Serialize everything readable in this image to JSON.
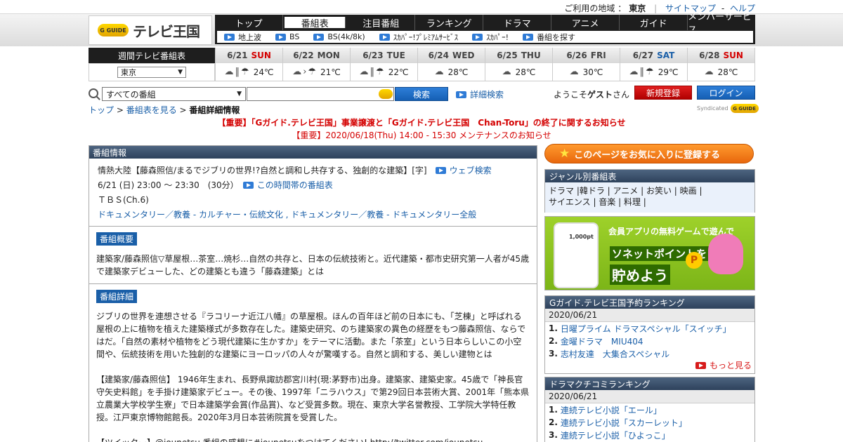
{
  "top": {
    "region_label": "ご利用の地域 ：",
    "region": "東京",
    "sitemap": "サイトマップ",
    "dash": "-",
    "help": "ヘルプ"
  },
  "logo": {
    "badge": "G GUIDE",
    "text": "テレビ王国"
  },
  "nav": [
    "トップ",
    "番組表",
    "注目番組",
    "ランキング",
    "ドラマ",
    "アニメ",
    "ガイド",
    "メンバーサービス"
  ],
  "subnav": [
    "地上波",
    "BS",
    "BS(4k/8k)",
    "ｽｶﾊﾟｰ!ﾌﾟﾚﾐｱﾑｻｰﾋﾞｽ",
    "ｽｶﾊﾟｰ!",
    "番組を探す"
  ],
  "week": {
    "title": "週間テレビ番組表",
    "area": "東京",
    "caret": "▼"
  },
  "days": [
    {
      "date": "6/21",
      "wd": "SUN",
      "temp": "24℃"
    },
    {
      "date": "6/22",
      "wd": "MON",
      "temp": "21℃"
    },
    {
      "date": "6/23",
      "wd": "TUE",
      "temp": "22℃"
    },
    {
      "date": "6/24",
      "wd": "WED",
      "temp": "28℃"
    },
    {
      "date": "6/25",
      "wd": "THU",
      "temp": "28℃"
    },
    {
      "date": "6/26",
      "wd": "FRI",
      "temp": "30℃"
    },
    {
      "date": "6/27",
      "wd": "SAT",
      "temp": "29℃"
    },
    {
      "date": "6/28",
      "wd": "SUN",
      "temp": "28℃"
    }
  ],
  "search": {
    "category": "すべての番組",
    "caret": "▼",
    "button": "検索",
    "advanced": "詳細検索",
    "welcome_pre": "ようこそ",
    "welcome_name": "ゲスト",
    "welcome_post": "さん",
    "register": "新規登録",
    "login": "ログイン"
  },
  "breadcrumb": {
    "top": "トップ",
    "sep": " > ",
    "schedule": "番組表を見る",
    "current": "番組詳細情報"
  },
  "syndicated": {
    "label": "Syndicated",
    "badge": "G GUIDE"
  },
  "notices": [
    "【重要】「Gガイド.テレビ王国」事業譲渡と「Gガイド.テレビ王国　Chan-Toru」の終了に関するお知らせ",
    "【重要】2020/06/18(Thu) 14:00 - 15:30 メンテナンスのお知らせ"
  ],
  "program": {
    "header": "番組情報",
    "title": "情熱大陸【藤森照信/まるでジブリの世界!?自然と調和し共存する、独創的な建築】[字]",
    "web_search": "ウェブ検索",
    "time": "6/21 (日) 23:00 ～ 23:30　(30分）",
    "time_link": "この時間帯の番組表",
    "channel": "ＴＢＳ(Ch.6)",
    "genres": "ドキュメンタリー／教養 - カルチャー・伝統文化 , ドキュメンタリー／教養 - ドキュメンタリー全般",
    "summary_label": "番組概要",
    "summary": "建築家/藤森照信▽草屋根…茶室…焼杉…自然の共存と、日本の伝統技術と。近代建築・都市史研究第一人者が45歳で建築家デビューした、どの建築とも違う「藤森建築」とは",
    "detail_label": "番組詳細",
    "detail_1": "ジブリの世界を連想させる『ラコリーナ近江八幡』の草屋根。ほんの百年ほど前の日本にも、「芝棟」と呼ばれる屋根の上に植物を植えた建築様式が多数存在した。建築史研究、のち建築家の異色の経歴をもつ藤森照信、ならではだ。「自然の素材や植物をどう現代建築に生かすか」をテーマに活動。また「茶室」という日本らしいこの小空間や、伝統技術を用いた独創的な建築にヨーロッパの人々が驚嘆する。自然と調和する、美しい建物とは",
    "detail_2": "【建築家/藤森照信】 1946年生まれ、長野県諏訪郡宮川村(現:茅野市)出身。建築家、建築史家。45歳で「神長官守矢史料館」を手掛け建築家デビュー。その後、1997年「ニラハウス」で第29回日本芸術大賞、2001年「熊本県立農業大学校学生寮」で日本建築学会賞(作品賞)、など受賞多数。現在、東京大学名誉教授、工学院大学特任教授。江戸東京博物館館長。2020年3月日本芸術院賞を受賞した。",
    "detail_3": "【ツイッター】@jounetsu 番組の感想に#jounetsuをつけてください! http://twitter.com/jounetsu"
  },
  "sidebar": {
    "favorite": "このページをお気に入りに登録する",
    "genre_header": "ジャンル別番組表",
    "genre_line1": "ドラマ |韓ドラ | アニメ | お笑い | 映画 |",
    "genre_line2": "サイエンス | 音楽 | 料理 |",
    "ad_line1": "会員アプリの無料ゲームで遊んで",
    "ad_line2": "ソネットポイントを",
    "ad_line3": "貯めよう",
    "ad_coin": "P",
    "ad_phone_label": "1,000pt",
    "rank1_header": "Gガイド.テレビ王国予約ランキング",
    "rank1_date": "2020/06/21",
    "rank1": [
      "日曜プライム ドラマスペシャル「スイッチ」",
      "金曜ドラマ　MIU404",
      "志村友達　大集合スペシャル"
    ],
    "more": "もっと見る",
    "rank2_header": "ドラマクチコミランキング",
    "rank2_date": "2020/06/21",
    "rank2": [
      "連続テレビ小説「エール」",
      "連続テレビ小説「スカーレット」",
      "連続テレビ小説「ひよっこ」"
    ]
  },
  "colors": {
    "nav_bg": "#1e1e1e",
    "link": "#1a5fa8",
    "alert": "#d40000",
    "section_header": "#3a5068",
    "favorite": "#f07a1a"
  }
}
